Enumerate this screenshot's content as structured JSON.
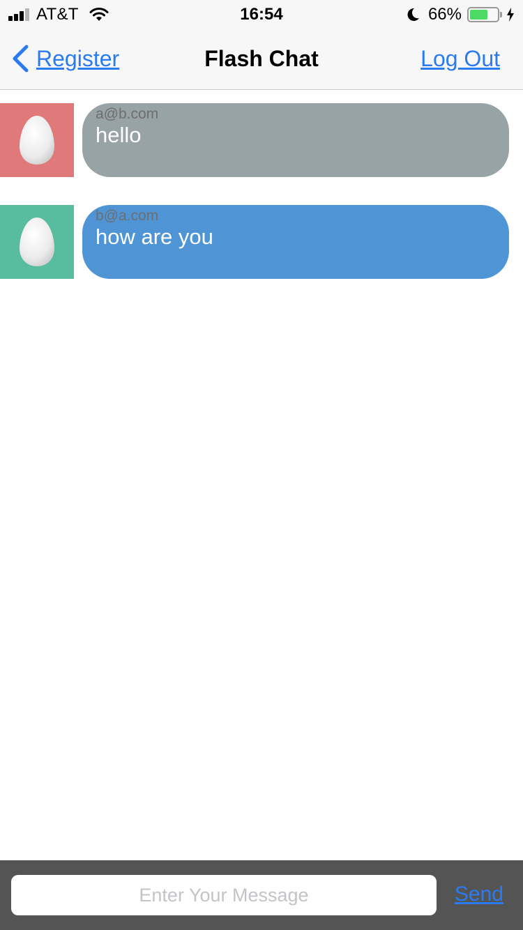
{
  "status_bar": {
    "carrier": "AT&T",
    "time": "16:54",
    "battery_percent": "66%",
    "battery_level": 0.66,
    "icons": [
      "signal-icon",
      "wifi-icon",
      "moon-icon",
      "battery-icon",
      "charging-bolt-icon"
    ]
  },
  "nav": {
    "back_label": "Register",
    "title": "Flash Chat",
    "logout_label": "Log Out"
  },
  "messages": [
    {
      "sender": "a@b.com",
      "text": "hello",
      "avatar_color": "#e07a7a",
      "bubble_color": "#97a3a4"
    },
    {
      "sender": "b@a.com",
      "text": "how are you",
      "avatar_color": "#57bd9e",
      "bubble_color": "#4f95d6"
    }
  ],
  "composer": {
    "placeholder": "Enter Your Message",
    "value": "",
    "send_label": "Send"
  },
  "colors": {
    "accent": "#2b7bf0",
    "composer_bg": "#545454"
  }
}
